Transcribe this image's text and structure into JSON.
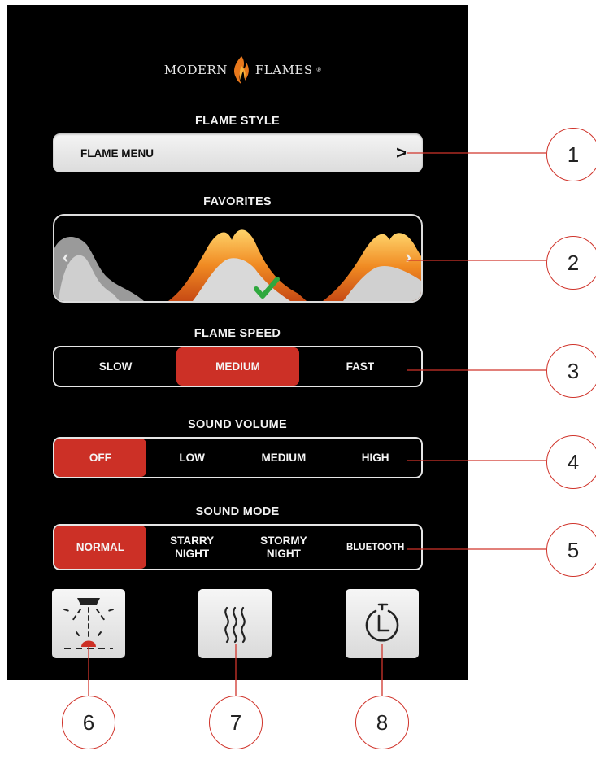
{
  "brand": {
    "left": "MODERN",
    "right": "FLAMES",
    "mark": "®"
  },
  "flame_style": {
    "title": "FLAME STYLE",
    "button_label": "FLAME MENU",
    "arrow": ">"
  },
  "favorites": {
    "title": "FAVORITES",
    "prev": "‹",
    "next": "›"
  },
  "flame_speed": {
    "title": "FLAME SPEED",
    "options": [
      "SLOW",
      "MEDIUM",
      "FAST"
    ],
    "selected": "MEDIUM"
  },
  "sound_volume": {
    "title": "SOUND VOLUME",
    "options": [
      "OFF",
      "LOW",
      "MEDIUM",
      "HIGH"
    ],
    "selected": "OFF"
  },
  "sound_mode": {
    "title": "SOUND MODE",
    "options": [
      "NORMAL",
      "STARRY\nNIGHT",
      "STORMY\nNIGHT",
      "BLUETOOTH"
    ],
    "selected": "NORMAL"
  },
  "icons": [
    "light-icon",
    "heat-icon",
    "timer-icon"
  ],
  "callouts": [
    "1",
    "2",
    "3",
    "4",
    "5",
    "6",
    "7",
    "8"
  ],
  "colors": {
    "accent": "#cc3026",
    "callout_line": "#d0342b",
    "background": "#000000"
  }
}
